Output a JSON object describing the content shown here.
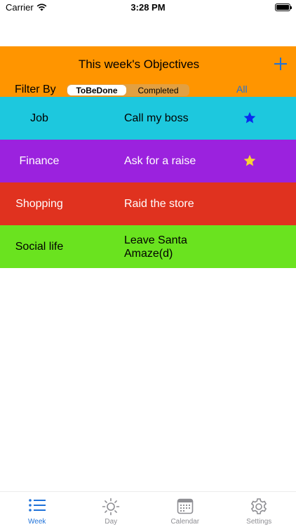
{
  "status_bar": {
    "carrier": "Carrier",
    "time": "3:28 PM"
  },
  "header": {
    "title": "This week's Objectives",
    "filter_label": "Filter By",
    "segments": [
      {
        "label": "ToBeDone",
        "selected": true
      },
      {
        "label": "Completed",
        "selected": false
      }
    ],
    "all_label": "All",
    "accent_color": "#1F72D9",
    "background_color": "#FF9500"
  },
  "objectives": [
    {
      "category": "Job",
      "title": "Call my boss",
      "star": "blue-star-icon",
      "color": "#1DC8DE"
    },
    {
      "category": "Finance",
      "title": "Ask for a raise",
      "star": "yellow-star-icon",
      "color": "#9B22DE"
    },
    {
      "category": "Shopping",
      "title": "Raid the store",
      "star": "",
      "color": "#E0321F"
    },
    {
      "category": "Social life",
      "title": "Leave Santa Amaze(d)",
      "star": "",
      "color": "#6AE31F"
    }
  ],
  "tabs": [
    {
      "label": "Week",
      "icon": "list-icon",
      "active": true
    },
    {
      "label": "Day",
      "icon": "sun-icon",
      "active": false
    },
    {
      "label": "Calendar",
      "icon": "calendar-icon",
      "active": false
    },
    {
      "label": "Settings",
      "icon": "gear-icon",
      "active": false
    }
  ]
}
